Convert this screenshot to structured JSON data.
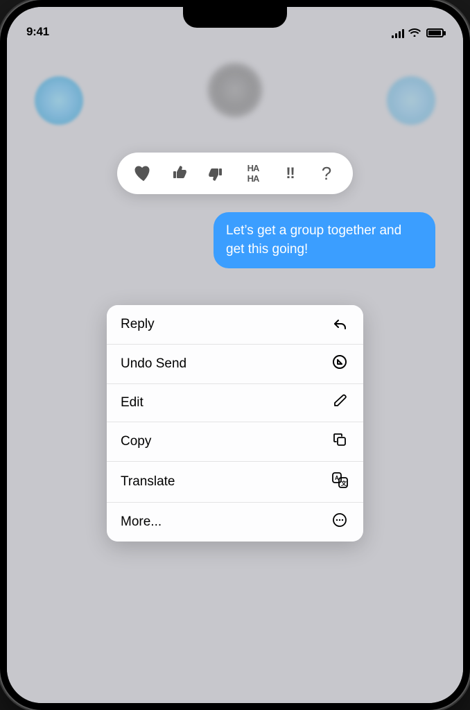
{
  "status_bar": {
    "time": "9:41",
    "signal": "signal-icon",
    "wifi": "wifi-icon",
    "battery": "battery-icon"
  },
  "reactions": {
    "items": [
      {
        "emoji": "♥",
        "name": "heart"
      },
      {
        "emoji": "👍",
        "name": "thumbs-up"
      },
      {
        "emoji": "👎",
        "name": "thumbs-down"
      },
      {
        "emoji": "HA HA",
        "name": "haha"
      },
      {
        "emoji": "‼",
        "name": "exclamation"
      },
      {
        "emoji": "?",
        "name": "question"
      }
    ]
  },
  "message": {
    "text": "Let’s get a group together and get this going!",
    "sender": "outgoing"
  },
  "context_menu": {
    "items": [
      {
        "label": "Reply",
        "icon": "↩",
        "name": "reply"
      },
      {
        "label": "Undo Send",
        "icon": "⊙",
        "name": "undo-send"
      },
      {
        "label": "Edit",
        "icon": "✏",
        "name": "edit"
      },
      {
        "label": "Copy",
        "icon": "⧉",
        "name": "copy"
      },
      {
        "label": "Translate",
        "icon": "⬡",
        "name": "translate"
      },
      {
        "label": "More...",
        "icon": "⋯",
        "name": "more"
      }
    ]
  }
}
